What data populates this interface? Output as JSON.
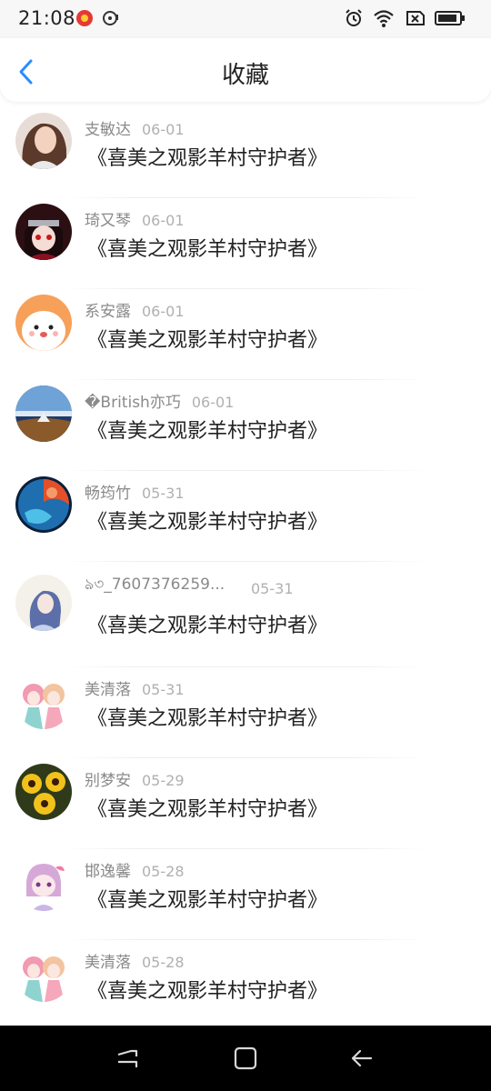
{
  "status_bar": {
    "time": "21:08"
  },
  "header": {
    "title": "收藏",
    "back_icon": "chevron-left-icon",
    "accent": "#2a8cff"
  },
  "items": [
    {
      "user": "支敏达",
      "date": "06-01",
      "title": "《喜美之观影羊村守护者》",
      "avatar": "portrait-avatar"
    },
    {
      "user": "琦又琴",
      "date": "06-01",
      "title": "《喜美之观影羊村守护者》",
      "avatar": "anime-ninja-avatar"
    },
    {
      "user": "系安露",
      "date": "06-01",
      "title": "《喜美之观影羊村守护者》",
      "avatar": "cartoon-animal-avatar"
    },
    {
      "user": "�British亦巧",
      "date": "06-01",
      "title": "《喜美之观影羊村守护者》",
      "avatar": "landscape-avatar"
    },
    {
      "user": "畅筠竹",
      "date": "05-31",
      "title": "《喜美之观影羊村守护者》",
      "avatar": "planet-avatar"
    },
    {
      "user": "ঌ৩_7607376259...",
      "date": "05-31",
      "title": "《喜美之观影羊村守护者》",
      "avatar": "illustration-girl-avatar"
    },
    {
      "user": "美清落",
      "date": "05-31",
      "title": "《喜美之观影羊村守护者》",
      "avatar": "anime-girls-avatar"
    },
    {
      "user": "别梦安",
      "date": "05-29",
      "title": "《喜美之观影羊村守护者》",
      "avatar": "flowers-avatar"
    },
    {
      "user": "邯逸馨",
      "date": "05-28",
      "title": "《喜美之观影羊村守护者》",
      "avatar": "chibi-girl-avatar"
    },
    {
      "user": "美清落",
      "date": "05-28",
      "title": "《喜美之观影羊村守护者》",
      "avatar": "anime-girls-avatar"
    }
  ],
  "nav_bar": {
    "recent_icon": "recent-apps-icon",
    "home_icon": "home-icon",
    "back_icon": "back-arrow-icon"
  }
}
